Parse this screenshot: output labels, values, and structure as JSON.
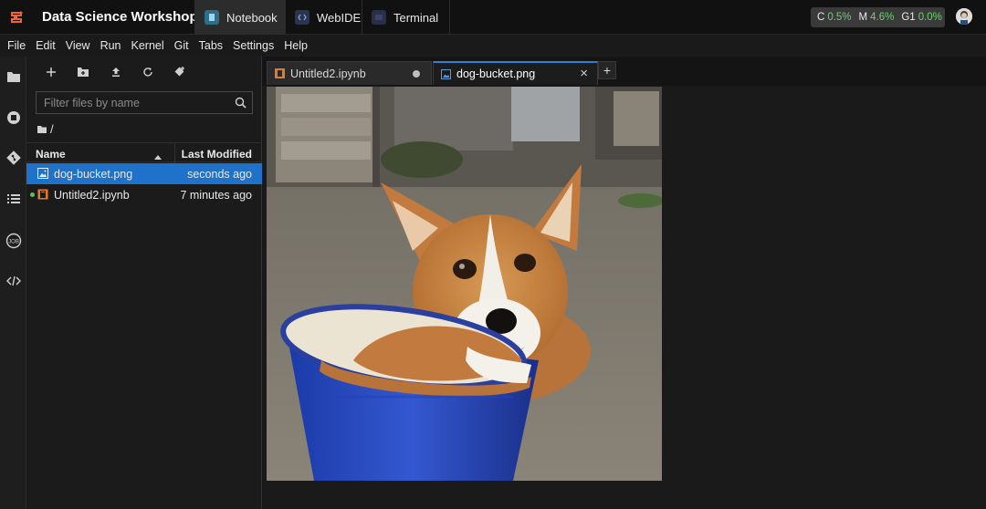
{
  "app": {
    "title": "Data Science Workshop",
    "logo_icon": "jupyter-logo-icon"
  },
  "top_tabs": [
    {
      "label": "Notebook",
      "icon": "notebook-icon",
      "active": true
    },
    {
      "label": "WebIDE",
      "icon": "code-editor-icon",
      "active": false
    },
    {
      "label": "Terminal",
      "icon": "terminal-icon",
      "active": false
    }
  ],
  "resources": {
    "cpu_label": "C",
    "cpu_value": "0.5%",
    "mem_label": "M",
    "mem_value": "4.6%",
    "gpu_label": "G1",
    "gpu_value": "0.0%"
  },
  "menu": [
    "File",
    "Edit",
    "View",
    "Run",
    "Kernel",
    "Git",
    "Tabs",
    "Settings",
    "Help"
  ],
  "activity_bar": [
    "folder-icon",
    "running-icon",
    "git-icon",
    "table-of-contents-icon",
    "job-icon",
    "code-icon"
  ],
  "file_browser": {
    "toolbar": [
      "new-launcher-icon",
      "new-folder-icon",
      "upload-icon",
      "refresh-icon",
      "git-clone-icon"
    ],
    "filter_placeholder": "Filter files by name",
    "path": "/",
    "columns": {
      "name": "Name",
      "modified": "Last Modified"
    },
    "files": [
      {
        "name": "dog-bucket.png",
        "modified": "seconds ago",
        "selected": true,
        "type": "image"
      },
      {
        "name": "Untitled2.ipynb",
        "modified": "7 minutes ago",
        "selected": false,
        "type": "notebook",
        "running": true
      }
    ]
  },
  "doc_tabs": [
    {
      "label": "Untitled2.ipynb",
      "icon": "notebook-icon",
      "active": false,
      "dirty": true
    },
    {
      "label": "dog-bucket.png",
      "icon": "image-icon",
      "active": true,
      "dirty": false
    }
  ],
  "add_tab_label": "+",
  "close_label": "×",
  "colors": {
    "accent": "#1f72c9",
    "running": "#56c456",
    "resource_value": "#6fcf6f",
    "notebook_icon": "#e07b2a"
  }
}
